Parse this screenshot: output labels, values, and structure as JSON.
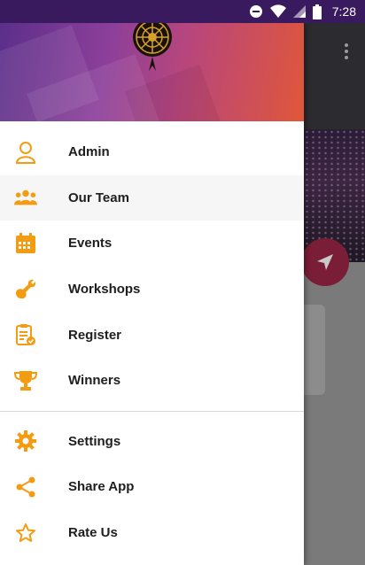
{
  "status_bar": {
    "time": "7:28",
    "icons": [
      "do-not-disturb-icon",
      "wifi-icon",
      "signal-icon",
      "battery-icon"
    ],
    "background": "#3a1a5e"
  },
  "drawer": {
    "accent_color": "#f39c12",
    "primary_items": [
      {
        "id": "admin",
        "label": "Admin",
        "icon": "person-icon"
      },
      {
        "id": "our-team",
        "label": "Our Team",
        "icon": "group-icon",
        "selected": true
      },
      {
        "id": "events",
        "label": "Events",
        "icon": "calendar-icon"
      },
      {
        "id": "workshops",
        "label": "Workshops",
        "icon": "wrench-icon"
      },
      {
        "id": "register",
        "label": "Register",
        "icon": "clipboard-check-icon"
      },
      {
        "id": "winners",
        "label": "Winners",
        "icon": "trophy-icon"
      }
    ],
    "secondary_items": [
      {
        "id": "settings",
        "label": "Settings",
        "icon": "gear-icon"
      },
      {
        "id": "share-app",
        "label": "Share App",
        "icon": "share-icon"
      },
      {
        "id": "rate-us",
        "label": "Rate Us",
        "icon": "star-outline-icon"
      }
    ]
  }
}
